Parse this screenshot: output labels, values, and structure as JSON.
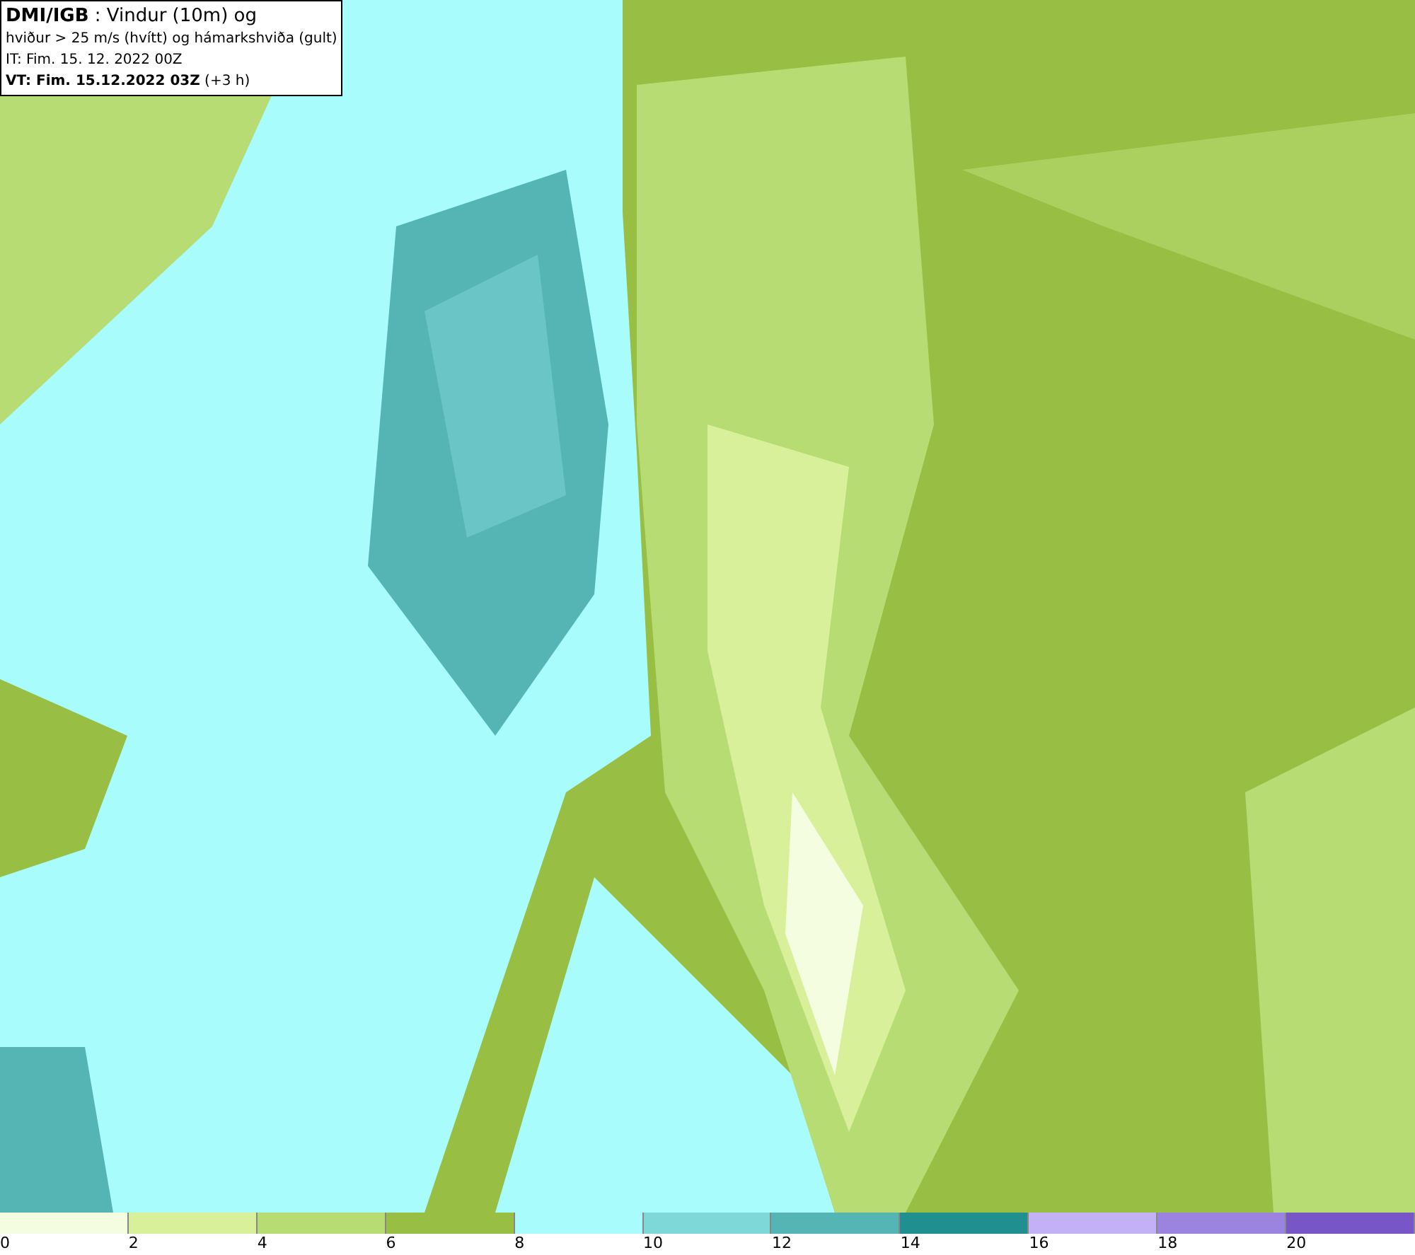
{
  "title_box": {
    "lines": [
      "**DMI/IGB** : Vindur (10m) og",
      "hviður > 25 m/s (hvítt) og hámarkshviða (gult)",
      "IT: Fim. 15. 12. 2022 00Z",
      "**VT: Fim. 15.12.2022 03Z** (+3 h)"
    ]
  },
  "legend": {
    "segments": [
      {
        "color": "#f5fde0"
      },
      {
        "color": "#d8f09a"
      },
      {
        "color": "#b7dc73"
      },
      {
        "color": "#98bf44"
      },
      {
        "color": "#a8fcfc"
      },
      {
        "color": "#7fd8d8"
      },
      {
        "color": "#55b5b5"
      },
      {
        "color": "#1f8f8f"
      },
      {
        "color": "#c2b2f5"
      },
      {
        "color": "#9a84e0"
      },
      {
        "color": "#7757c7"
      }
    ],
    "labels": [
      "0",
      "2",
      "4",
      "6",
      "8",
      "10",
      "12",
      "14",
      "16",
      "18",
      "20"
    ]
  }
}
